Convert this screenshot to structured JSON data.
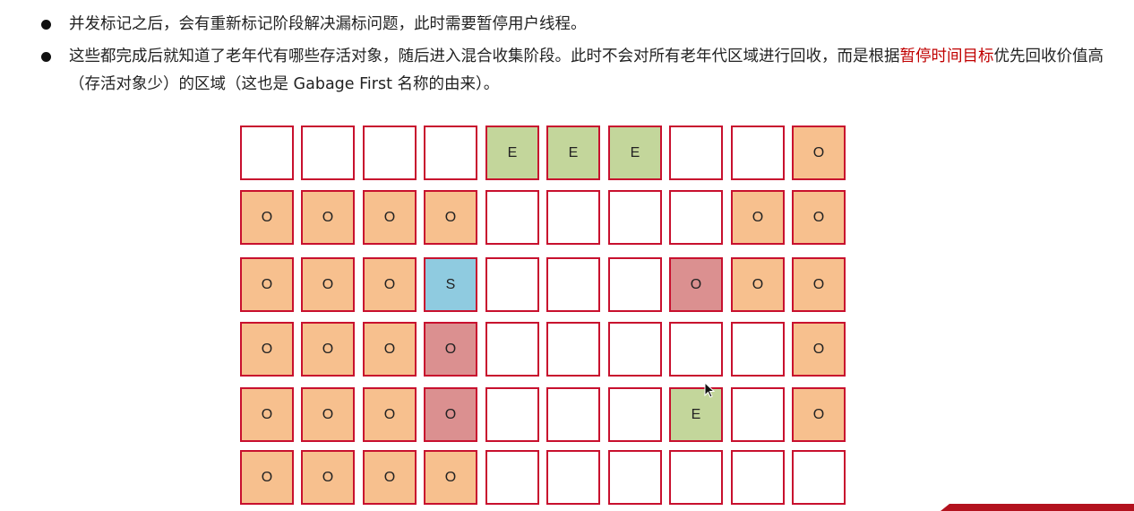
{
  "bullets": [
    {
      "text": "并发标记之后，会有重新标记阶段解决漏标问题，此时需要暂停用户线程。"
    },
    {
      "text_before": "这些都完成后就知道了老年代有哪些存活对象，随后进入混合收集阶段。此时不会对所有老年代区域进行回收，而是根据",
      "highlight": "暂停时间目标",
      "text_after": "优先回收价值高（存活对象少）的区域（这也是 Gabage First 名称的由来）。",
      "highlight_color": "#c00000"
    }
  ],
  "region_grid": {
    "rows": [
      [
        {
          "label": "",
          "type": "empty"
        },
        {
          "label": "",
          "type": "empty"
        },
        {
          "label": "",
          "type": "empty"
        },
        {
          "label": "",
          "type": "empty"
        },
        {
          "label": "E",
          "type": "eden"
        },
        {
          "label": "E",
          "type": "eden"
        },
        {
          "label": "E",
          "type": "eden"
        },
        {
          "label": "",
          "type": "empty"
        },
        {
          "label": "",
          "type": "empty"
        },
        {
          "label": "O",
          "type": "old"
        }
      ],
      [
        {
          "label": "O",
          "type": "old"
        },
        {
          "label": "O",
          "type": "old"
        },
        {
          "label": "O",
          "type": "old"
        },
        {
          "label": "O",
          "type": "old"
        },
        {
          "label": "",
          "type": "empty"
        },
        {
          "label": "",
          "type": "empty"
        },
        {
          "label": "",
          "type": "empty"
        },
        {
          "label": "",
          "type": "empty"
        },
        {
          "label": "O",
          "type": "old"
        },
        {
          "label": "O",
          "type": "old"
        }
      ],
      [
        {
          "label": "O",
          "type": "old"
        },
        {
          "label": "O",
          "type": "old"
        },
        {
          "label": "O",
          "type": "old"
        },
        {
          "label": "S",
          "type": "survivor"
        },
        {
          "label": "",
          "type": "empty"
        },
        {
          "label": "",
          "type": "empty"
        },
        {
          "label": "",
          "type": "empty"
        },
        {
          "label": "O",
          "type": "old-selected"
        },
        {
          "label": "O",
          "type": "old"
        },
        {
          "label": "O",
          "type": "old"
        }
      ],
      [
        {
          "label": "O",
          "type": "old"
        },
        {
          "label": "O",
          "type": "old"
        },
        {
          "label": "O",
          "type": "old"
        },
        {
          "label": "O",
          "type": "old-selected"
        },
        {
          "label": "",
          "type": "empty"
        },
        {
          "label": "",
          "type": "empty"
        },
        {
          "label": "",
          "type": "empty"
        },
        {
          "label": "",
          "type": "empty"
        },
        {
          "label": "",
          "type": "empty"
        },
        {
          "label": "O",
          "type": "old"
        }
      ],
      [
        {
          "label": "O",
          "type": "old"
        },
        {
          "label": "O",
          "type": "old"
        },
        {
          "label": "O",
          "type": "old"
        },
        {
          "label": "O",
          "type": "old-selected"
        },
        {
          "label": "",
          "type": "empty"
        },
        {
          "label": "",
          "type": "empty"
        },
        {
          "label": "",
          "type": "empty"
        },
        {
          "label": "E",
          "type": "eden"
        },
        {
          "label": "",
          "type": "empty"
        },
        {
          "label": "O",
          "type": "old"
        }
      ],
      [
        {
          "label": "O",
          "type": "old"
        },
        {
          "label": "O",
          "type": "old"
        },
        {
          "label": "O",
          "type": "old"
        },
        {
          "label": "O",
          "type": "old"
        },
        {
          "label": "",
          "type": "empty"
        },
        {
          "label": "",
          "type": "empty"
        },
        {
          "label": "",
          "type": "empty"
        },
        {
          "label": "",
          "type": "empty"
        },
        {
          "label": "",
          "type": "empty"
        },
        {
          "label": "",
          "type": "empty"
        }
      ]
    ],
    "colors": {
      "border": "#c8102e",
      "old": "#f7c08e",
      "eden": "#c3d69b",
      "survivor": "#8fcbe0",
      "old-selected": "#db9090",
      "empty": "#ffffff"
    }
  },
  "icons": {
    "cursor": "mouse-pointer-icon",
    "bullet": "bullet-dot-icon"
  }
}
